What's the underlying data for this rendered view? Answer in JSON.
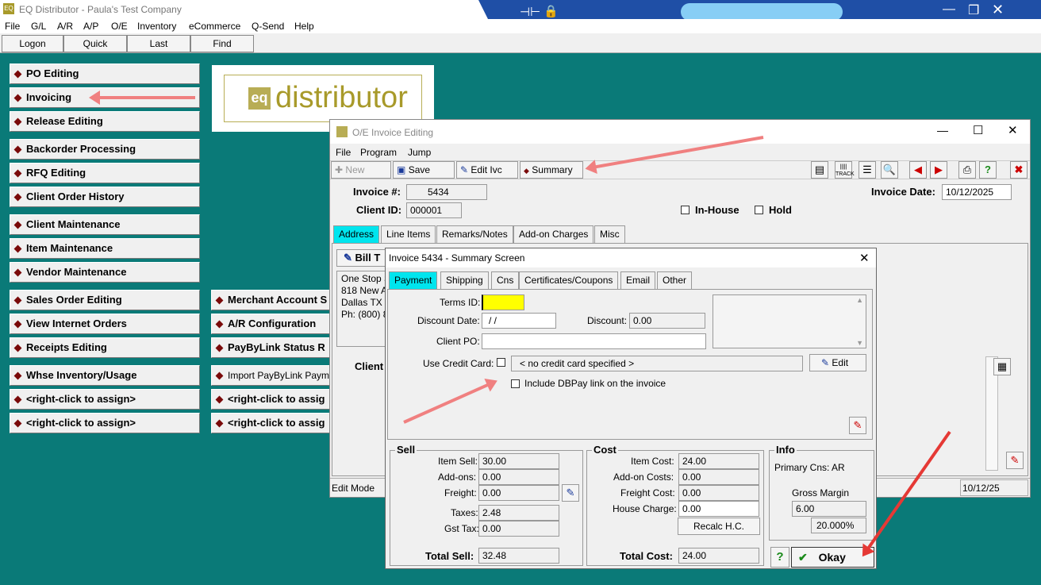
{
  "app": {
    "title": "EQ Distributor - Paula's Test Company",
    "logo_text": "EQ"
  },
  "menu": [
    "File",
    "G/L",
    "A/R",
    "A/P",
    "O/E",
    "Inventory",
    "eCommerce",
    "Q-Send",
    "Help"
  ],
  "toolbar": [
    "Logon",
    "Quick",
    "Last",
    "Find"
  ],
  "nav_left": [
    "PO Editing",
    "Invoicing",
    "Release Editing",
    "Backorder Processing",
    "RFQ Editing",
    "Client Order History",
    "Client Maintenance",
    "Item Maintenance",
    "Vendor Maintenance",
    "Sales Order Editing",
    "View Internet Orders",
    "Receipts Editing",
    "Whse Inventory/Usage",
    "<right-click to assign>",
    "<right-click to assign>"
  ],
  "nav_right": [
    "Merchant Account S",
    "A/R Configuration",
    "PayByLink Status R",
    "Import PayByLink Payme",
    "<right-click to assig",
    "<right-click to assig"
  ],
  "brand": {
    "eq": "eq",
    "name": "distributor"
  },
  "invoice_window": {
    "title": "O/E Invoice Editing",
    "menu": [
      "File",
      "Program",
      "Jump"
    ],
    "toolbar": {
      "new": "New",
      "save": "Save",
      "edit": "Edit Ivc",
      "summary": "Summary",
      "track": "TRACK"
    },
    "invoice_label": "Invoice #:",
    "invoice_no": "5434",
    "client_label": "Client ID:",
    "client_id": "000001",
    "inhouse": "In-House",
    "hold": "Hold",
    "date_label": "Invoice Date:",
    "date": "10/12/2025",
    "tabs": [
      "Address",
      "Line Items",
      "Remarks/Notes",
      "Add-on Charges",
      "Misc"
    ],
    "bill_to": "Bill T",
    "address_lines": [
      "One Stop S",
      "818 New A",
      "Dallas  TX",
      "Ph: (800) 8"
    ],
    "client_label2": "Client",
    "status_mode": "Edit Mode",
    "status_date": "10/12/25"
  },
  "summary": {
    "title": "Invoice 5434 - Summary Screen",
    "tabs": [
      "Payment",
      "Shipping",
      "Cns",
      "Certificates/Coupons",
      "Email",
      "Other"
    ],
    "terms_label": "Terms ID:",
    "terms": "",
    "disc_date_label": "Discount Date:",
    "disc_date": " /  /",
    "discount_label": "Discount:",
    "discount": "0.00",
    "client_po_label": "Client PO:",
    "client_po": "",
    "use_cc_label": "Use Credit Card:",
    "cc_value": "< no credit card specified >",
    "edit": "Edit",
    "dbpay_label": "Include DBPay link on the invoice",
    "sell": {
      "title": "Sell",
      "item_sell_l": "Item Sell:",
      "item_sell": "30.00",
      "addons_l": "Add-ons:",
      "addons": "0.00",
      "freight_l": "Freight:",
      "freight": "0.00",
      "taxes_l": "Taxes:",
      "taxes": "2.48",
      "gst_l": "Gst Tax:",
      "gst": "0.00",
      "total_l": "Total Sell:",
      "total": "32.48"
    },
    "cost": {
      "title": "Cost",
      "item_cost_l": "Item Cost:",
      "item_cost": "24.00",
      "addon_l": "Add-on Costs:",
      "addon": "0.00",
      "freight_l": "Freight Cost:",
      "freight": "0.00",
      "house_l": "House Charge:",
      "house": "0.00",
      "recalc": "Recalc H.C.",
      "total_l": "Total Cost:",
      "total": "24.00"
    },
    "info": {
      "title": "Info",
      "primary": "Primary Cns: AR",
      "gm_l": "Gross Margin",
      "gm": "6.00",
      "gm_pct": "20.000%"
    },
    "help": "?",
    "okay": "Okay"
  },
  "colors": {
    "bg": "#0a7a78",
    "active_tab": "#00e5ee",
    "terms_bg": "#ffff00",
    "arrow": "#f08080"
  }
}
